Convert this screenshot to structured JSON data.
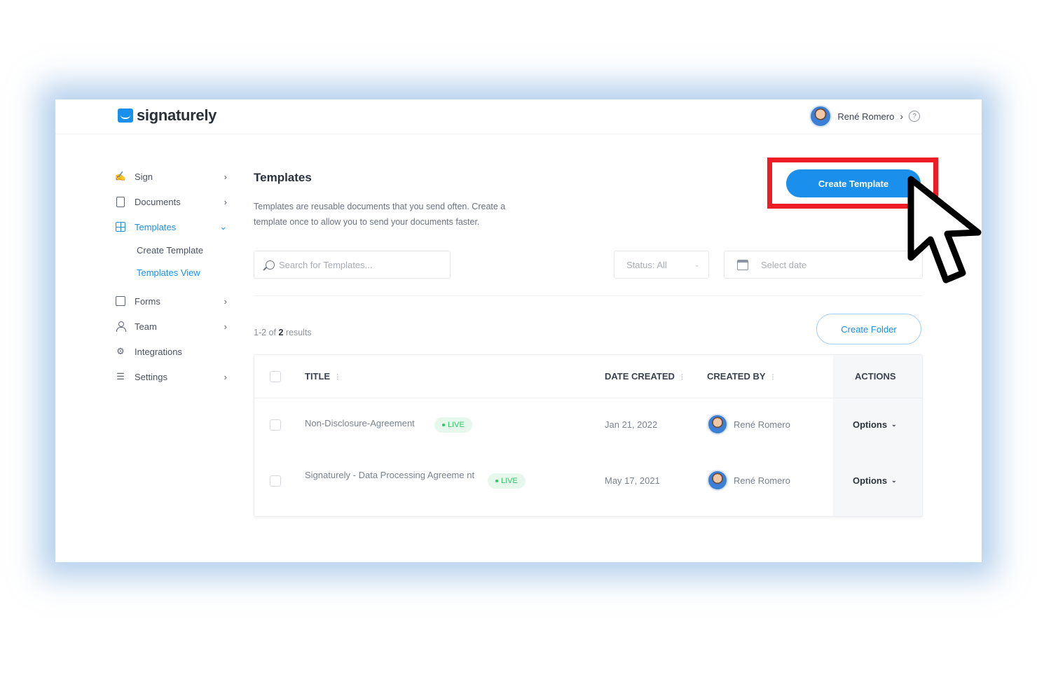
{
  "app": {
    "brand": "signaturely",
    "accent": "#1b8fec"
  },
  "header": {
    "user_name": "René Romero",
    "help_icon": "?"
  },
  "sidebar": {
    "items": [
      {
        "label": "Sign",
        "icon": "signature-icon",
        "has_arrow": true
      },
      {
        "label": "Documents",
        "icon": "document-icon",
        "has_arrow": true
      },
      {
        "label": "Templates",
        "icon": "templates-icon",
        "active": true,
        "expanded": true
      },
      {
        "label": "Forms",
        "icon": "form-icon",
        "has_arrow": true
      },
      {
        "label": "Team",
        "icon": "user-icon",
        "has_arrow": true
      },
      {
        "label": "Integrations",
        "icon": "gear-icon"
      },
      {
        "label": "Settings",
        "icon": "sliders-icon",
        "has_arrow": true
      }
    ],
    "templates_sub": [
      {
        "label": "Create Template"
      },
      {
        "label": "Templates View",
        "active": true
      }
    ]
  },
  "main": {
    "title": "Templates",
    "description": "Templates are reusable documents that you send often. Create a template once to allow you to send your documents faster.",
    "create_template_label": "Create Template",
    "search_placeholder": "Search for Templates...",
    "status_filter": "Status: All",
    "date_placeholder": "Select date",
    "results_prefix": "1-2 of ",
    "results_count": "2",
    "results_suffix": " results",
    "create_folder_label": "Create Folder"
  },
  "table": {
    "columns": [
      "TITLE",
      "DATE CREATED",
      "CREATED BY",
      "ACTIONS"
    ],
    "rows": [
      {
        "title": "Non-Disclosure-Agreement",
        "status": "LIVE",
        "date": "Jan 21, 2022",
        "creator": "René Romero",
        "action": "Options"
      },
      {
        "title": "Signaturely - Data Processing Agreeme nt",
        "status": "LIVE",
        "date": "May 17, 2021",
        "creator": "René Romero",
        "action": "Options"
      }
    ]
  },
  "overlay": {
    "highlight_color": "#ee1c25"
  }
}
